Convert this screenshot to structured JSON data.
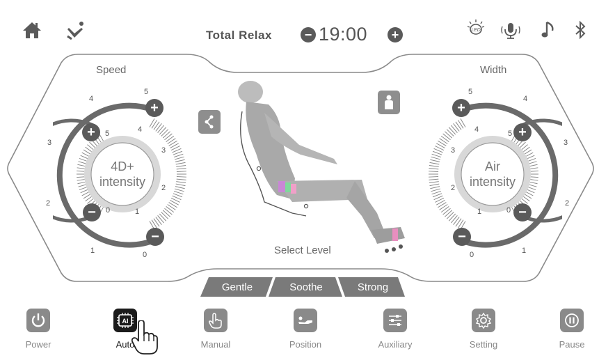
{
  "header": {
    "program_name": "Total Relax",
    "timer": "19:00",
    "timer_decrease_symbol": "−",
    "timer_increase_symbol": "+",
    "left_icons": [
      "home-icon",
      "zero-gravity-icon"
    ],
    "right_icons": [
      "led-icon",
      "voice-icon",
      "music-icon",
      "bluetooth-icon"
    ]
  },
  "speed_dial": {
    "title": "Speed",
    "center_line1": "4D+",
    "center_line2": "intensity",
    "outer_ticks": [
      "0",
      "1",
      "2",
      "3",
      "4",
      "5"
    ],
    "inner_ticks": [
      "0",
      "1",
      "2",
      "3",
      "4",
      "5"
    ],
    "plus_symbol": "+",
    "minus_symbol": "−"
  },
  "width_dial": {
    "title": "Width",
    "center_line1": "Air",
    "center_line2": "intensity",
    "outer_ticks": [
      "0",
      "1",
      "2",
      "3",
      "4",
      "5"
    ],
    "inner_ticks": [
      "0",
      "1",
      "2",
      "3",
      "4",
      "5"
    ],
    "plus_symbol": "+",
    "minus_symbol": "−"
  },
  "center": {
    "select_level_label": "Select Level",
    "levels": [
      "Gentle",
      "Soothe",
      "Strong"
    ],
    "share_icon": "share-icon",
    "body_icon": "body-scan-icon"
  },
  "nav": [
    {
      "label": "Power",
      "icon": "power-icon",
      "active": false
    },
    {
      "label": "Auto",
      "icon": "ai-chip-icon",
      "active": true
    },
    {
      "label": "Manual",
      "icon": "hand-icon",
      "active": false
    },
    {
      "label": "Position",
      "icon": "recline-icon",
      "active": false
    },
    {
      "label": "Auxiliary",
      "icon": "sliders-icon",
      "active": false
    },
    {
      "label": "Setting",
      "icon": "gear-icon",
      "active": false
    },
    {
      "label": "Pause",
      "icon": "pause-icon",
      "active": false
    }
  ],
  "colors": {
    "icon_dark": "#5a5a5a",
    "icon_gray": "#8a8a8a",
    "level_tab": "#7a7a7a",
    "active_nav": "#1b1b1b"
  }
}
